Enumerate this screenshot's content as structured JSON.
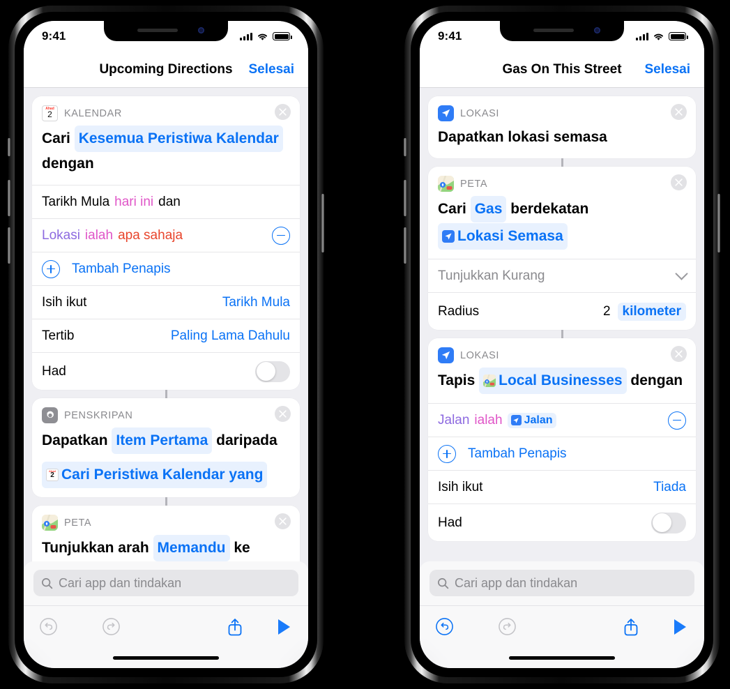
{
  "colors": {
    "accent": "#0a72f5",
    "token_bg": "#e8f1fe",
    "page_bg": "#EFEFF3",
    "card_bg": "#ffffff",
    "muted": "#8a8a8e",
    "purple": "#8d6ae0",
    "magenta": "#e056c8",
    "red": "#e8452c"
  },
  "phones": [
    {
      "id": "left",
      "status": {
        "time": "9:41",
        "signal_icon": "cellular-bars-icon",
        "wifi_icon": "wifi-icon",
        "battery_icon": "battery-icon"
      },
      "nav": {
        "title": "Upcoming Directions",
        "done_label": "Selesai"
      },
      "cards": [
        {
          "app_label": "KALENDAR",
          "icon": "calendar-icon",
          "icon_day": "2",
          "icon_weekday": "Ahad",
          "statement": {
            "pre": "Cari",
            "token": "Kesemua Peristiwa Kalendar",
            "post": "dengan"
          },
          "rows": [
            {
              "type": "text",
              "label": "Tarikh Mula",
              "mid": "hari ini",
              "tail": "dan"
            },
            {
              "type": "filter",
              "label": "Lokasi",
              "verb": "ialah",
              "value": "apa sahaja",
              "action": "remove-filter"
            },
            {
              "type": "add",
              "label": "Tambah Penapis"
            },
            {
              "type": "value",
              "label": "Isih ikut",
              "value": "Tarikh Mula"
            },
            {
              "type": "value",
              "label": "Tertib",
              "value": "Paling Lama Dahulu"
            },
            {
              "type": "toggle",
              "label": "Had",
              "on": false
            }
          ]
        },
        {
          "app_label": "PENSKRIPAN",
          "icon": "gear-icon",
          "statement2": {
            "pre": "Dapatkan",
            "token": "Item Pertama",
            "mid": "daripada",
            "token2": "Cari Peristiwa Kalendar yang",
            "token2_icon": "calendar-icon"
          },
          "rows": []
        },
        {
          "app_label": "PETA",
          "icon": "maps-icon",
          "statement3": {
            "pre": "Tunjukkan arah",
            "token": "Memandu",
            "post": "ke"
          },
          "rows": []
        }
      ],
      "search": {
        "placeholder": "Cari app dan tindakan",
        "icon": "search-icon"
      },
      "toolbar": {
        "undo": {
          "icon": "undo-icon",
          "enabled": false
        },
        "redo": {
          "icon": "redo-icon",
          "enabled": false
        },
        "share": {
          "icon": "share-icon",
          "enabled": true
        },
        "play": {
          "icon": "play-icon",
          "enabled": true
        }
      }
    },
    {
      "id": "right",
      "status": {
        "time": "9:41",
        "signal_icon": "cellular-bars-icon",
        "wifi_icon": "wifi-icon",
        "battery_icon": "battery-icon"
      },
      "nav": {
        "title": "Gas On This Street",
        "done_label": "Selesai"
      },
      "cards": [
        {
          "app_label": "LOKASI",
          "icon": "location-icon",
          "statement_plain": "Dapatkan lokasi semasa",
          "rows": []
        },
        {
          "app_label": "PETA",
          "icon": "maps-icon",
          "statement": {
            "pre": "Cari",
            "token": "Gas",
            "post": "berdekatan",
            "token2": "Lokasi Semasa",
            "token2_icon": "location-icon"
          },
          "rows": [
            {
              "type": "disclosure",
              "label": "Tunjukkan Kurang",
              "icon": "chevron-down-icon"
            },
            {
              "type": "radius",
              "label": "Radius",
              "number": "2",
              "unit": "kilometer"
            }
          ]
        },
        {
          "app_label": "LOKASI",
          "icon": "location-icon",
          "statement4": {
            "pre": "Tapis",
            "token": "Local Businesses",
            "token_icon": "maps-icon",
            "post": "dengan"
          },
          "rows": [
            {
              "type": "filter_token",
              "label": "Jalan",
              "verb": "ialah",
              "token": "Jalan",
              "token_icon": "location-icon",
              "action": "remove-filter"
            },
            {
              "type": "add",
              "label": "Tambah Penapis"
            },
            {
              "type": "value",
              "label": "Isih ikut",
              "value": "Tiada"
            },
            {
              "type": "toggle",
              "label": "Had",
              "on": false
            }
          ]
        }
      ],
      "search": {
        "placeholder": "Cari app dan tindakan",
        "icon": "search-icon"
      },
      "toolbar": {
        "undo": {
          "icon": "undo-icon",
          "enabled": true
        },
        "redo": {
          "icon": "redo-icon",
          "enabled": false
        },
        "share": {
          "icon": "share-icon",
          "enabled": true
        },
        "play": {
          "icon": "play-icon",
          "enabled": true
        }
      }
    }
  ]
}
